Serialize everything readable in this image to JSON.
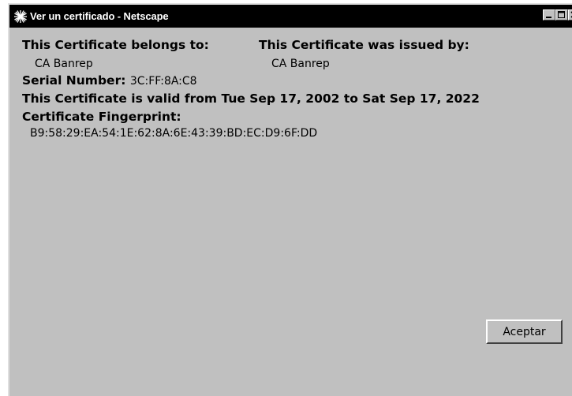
{
  "window": {
    "title": "Ver un certificado - Netscape",
    "icon": "netscape-starburst-icon"
  },
  "certificate": {
    "belongs_to_label": "This Certificate belongs to:",
    "belongs_to_value": "CA Banrep",
    "issued_by_label": "This Certificate was issued by:",
    "issued_by_value": "CA Banrep",
    "serial_label": "Serial Number:",
    "serial_value": "3C:FF:8A:C8",
    "validity_text": "This Certificate is valid from Tue Sep 17, 2002 to Sat Sep 17, 2022",
    "fingerprint_label": "Certificate Fingerprint:",
    "fingerprint_value": "B9:58:29:EA:54:1E:62:8A:6E:43:39:BD:EC:D9:6F:DD"
  },
  "buttons": {
    "accept_label": "Aceptar"
  },
  "colors": {
    "window_bg": "#c0c0c0",
    "titlebar_bg": "#000000",
    "titlebar_text": "#ffffff"
  }
}
